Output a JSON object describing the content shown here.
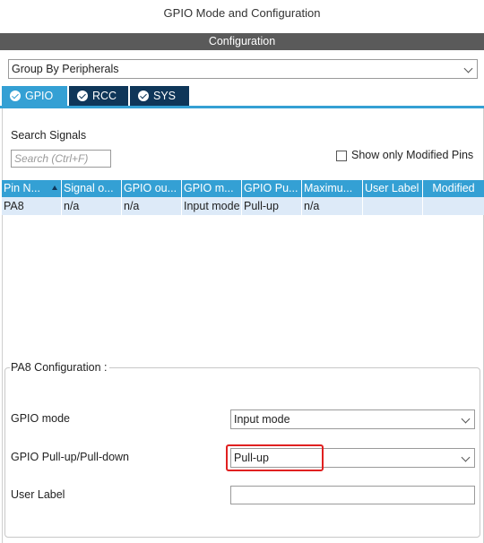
{
  "window": {
    "title": "GPIO Mode and Configuration"
  },
  "section": {
    "title": "Configuration"
  },
  "group_select": {
    "value": "Group By Peripherals"
  },
  "tabs": [
    {
      "label": "GPIO",
      "active": true
    },
    {
      "label": "RCC",
      "active": false
    },
    {
      "label": "SYS",
      "active": false
    }
  ],
  "search": {
    "label": "Search Signals",
    "placeholder": "Search (Ctrl+F)"
  },
  "show_modified": {
    "label": "Show only Modified Pins",
    "checked": false
  },
  "table": {
    "columns": [
      "Pin N...",
      "Signal o...",
      "GPIO ou...",
      "GPIO m...",
      "GPIO Pu...",
      "Maximu...",
      "User Label",
      "Modified"
    ],
    "rows": [
      {
        "pin": "PA8",
        "signal": "n/a",
        "output": "n/a",
        "mode": "Input mode",
        "pull": "Pull-up",
        "max": "n/a",
        "user_label": "",
        "modified": true
      }
    ]
  },
  "config": {
    "title": "PA8 Configuration :",
    "gpio_mode": {
      "label": "GPIO mode",
      "value": "Input mode"
    },
    "pull": {
      "label": "GPIO Pull-up/Pull-down",
      "value": "Pull-up"
    },
    "user_label": {
      "label": "User Label",
      "value": ""
    }
  },
  "colors": {
    "accent": "#34a0d4",
    "tab_dark": "#0f3659",
    "header_gray": "#5a5a5a",
    "highlight": "#e02020"
  }
}
